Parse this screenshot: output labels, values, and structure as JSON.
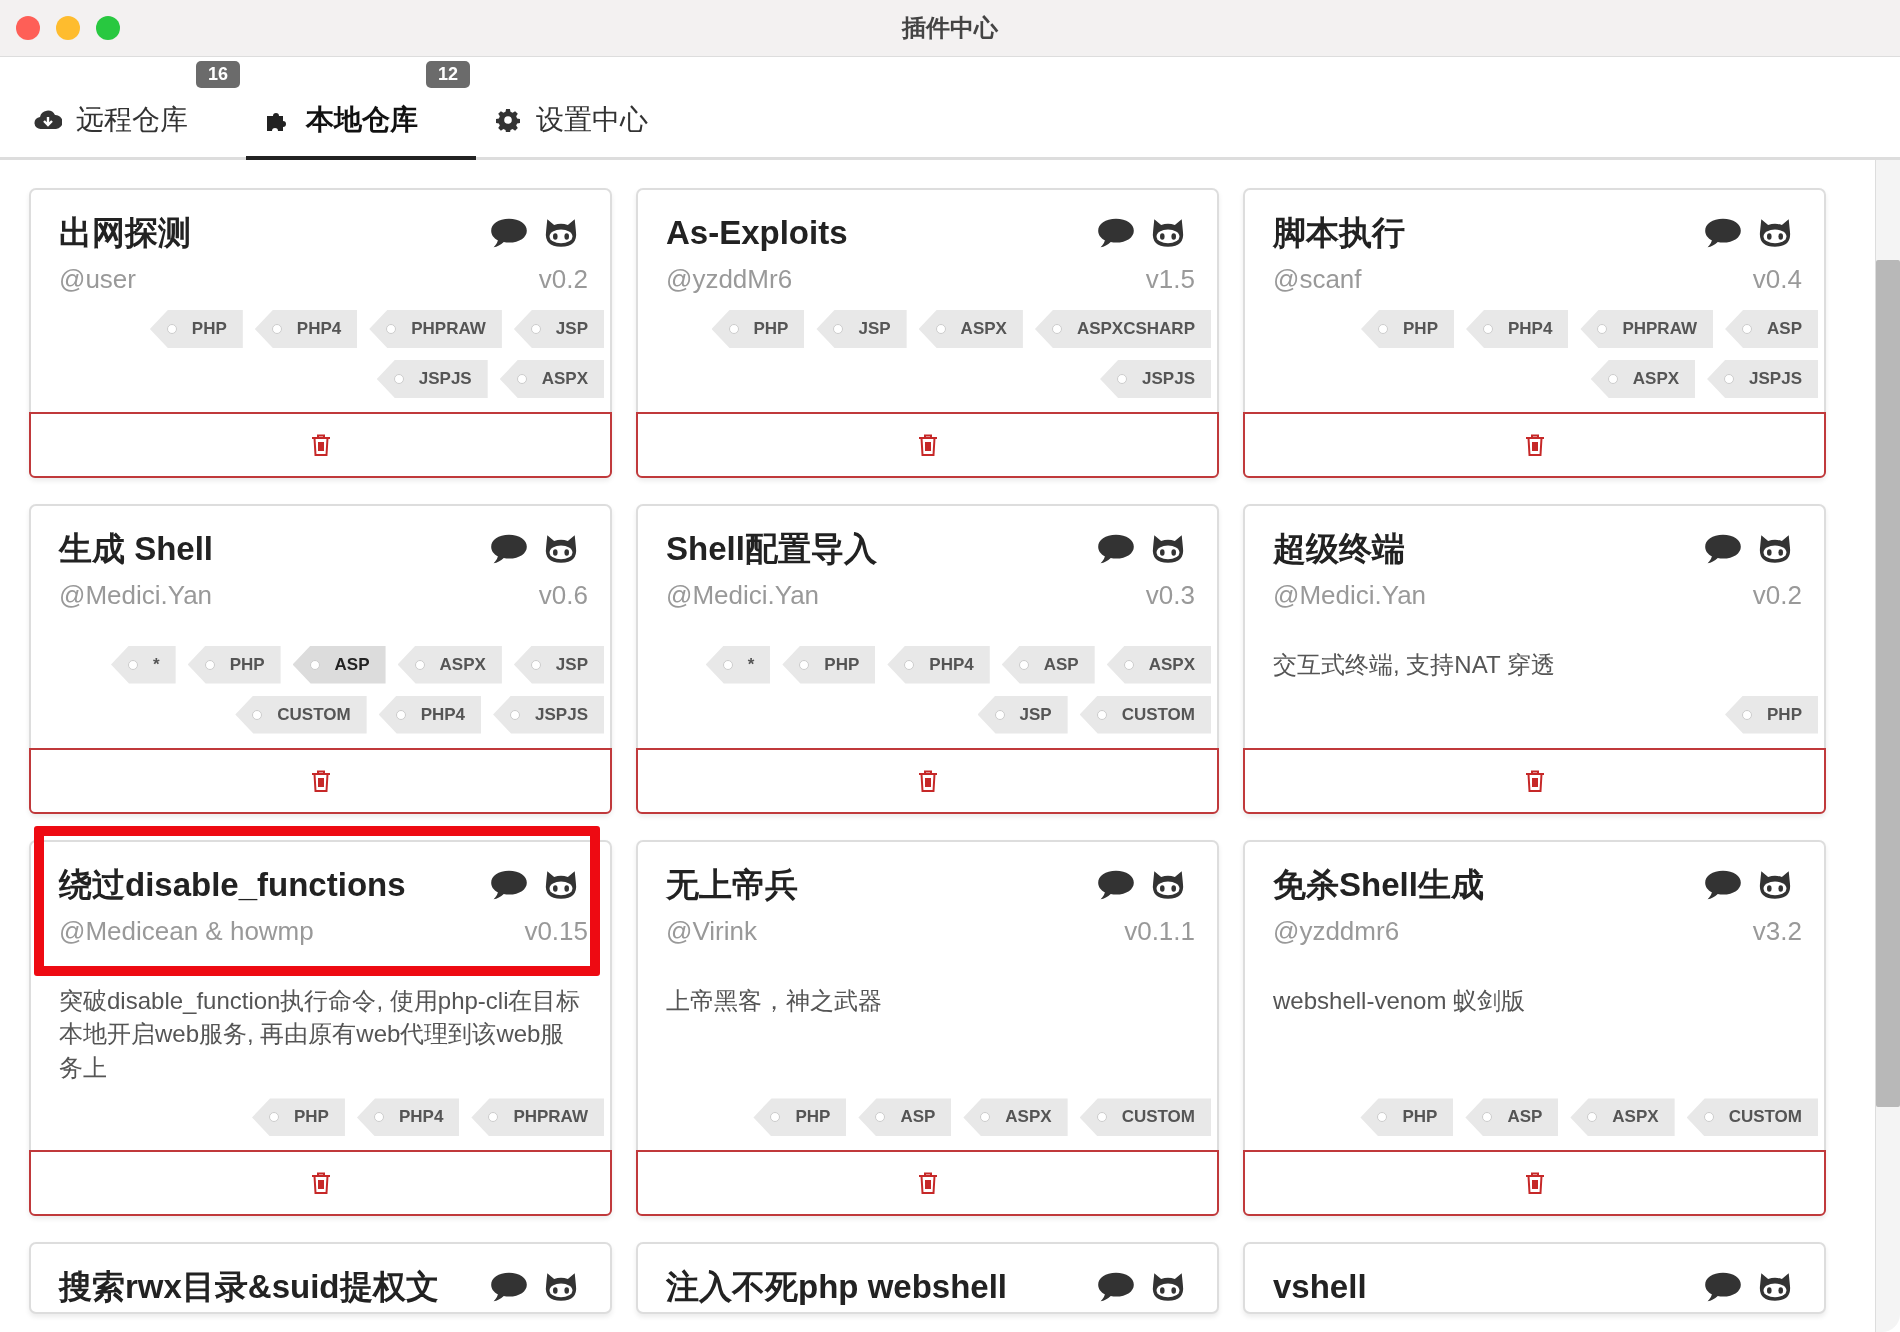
{
  "window": {
    "title": "插件中心"
  },
  "tabs": [
    {
      "label": "远程仓库",
      "badge": "16",
      "selected": false
    },
    {
      "label": "本地仓库",
      "badge": "12",
      "selected": true
    },
    {
      "label": "设置中心",
      "selected": false
    }
  ],
  "cards": [
    {
      "title": "出网探测",
      "author": "@user",
      "version": "v0.2",
      "highlighted": false,
      "tags": [
        {
          "label": "PHP",
          "selected": false
        },
        {
          "label": "PHP4",
          "selected": false
        },
        {
          "label": "PHPRAW",
          "selected": false
        },
        {
          "label": "JSP",
          "selected": false
        },
        {
          "label": "JSPJS",
          "selected": false
        },
        {
          "label": "ASPX",
          "selected": false
        }
      ]
    },
    {
      "title": "As-Exploits",
      "author": "@yzddMr6",
      "version": "v1.5",
      "highlighted": false,
      "tags": [
        {
          "label": "PHP",
          "selected": false
        },
        {
          "label": "JSP",
          "selected": false
        },
        {
          "label": "ASPX",
          "selected": false
        },
        {
          "label": "ASPXCSHARP",
          "selected": false
        },
        {
          "label": "JSPJS",
          "selected": false
        }
      ]
    },
    {
      "title": "脚本执行",
      "author": "@scanf",
      "version": "v0.4",
      "highlighted": false,
      "tags": [
        {
          "label": "PHP",
          "selected": false
        },
        {
          "label": "PHP4",
          "selected": false
        },
        {
          "label": "PHPRAW",
          "selected": false
        },
        {
          "label": "ASP",
          "selected": false
        },
        {
          "label": "ASPX",
          "selected": false
        },
        {
          "label": "JSPJS",
          "selected": false
        }
      ]
    },
    {
      "title": "生成 Shell",
      "author": "@Medici.Yan",
      "version": "v0.6",
      "highlighted": false,
      "tags": [
        {
          "label": "*",
          "selected": false
        },
        {
          "label": "PHP",
          "selected": false
        },
        {
          "label": "ASP",
          "selected": true
        },
        {
          "label": "ASPX",
          "selected": false
        },
        {
          "label": "JSP",
          "selected": false
        },
        {
          "label": "CUSTOM",
          "selected": false
        },
        {
          "label": "PHP4",
          "selected": false
        },
        {
          "label": "JSPJS",
          "selected": false
        }
      ]
    },
    {
      "title": "Shell配置导入",
      "author": "@Medici.Yan",
      "version": "v0.3",
      "highlighted": false,
      "tags": [
        {
          "label": "*",
          "selected": false
        },
        {
          "label": "PHP",
          "selected": false
        },
        {
          "label": "PHP4",
          "selected": false
        },
        {
          "label": "ASP",
          "selected": false
        },
        {
          "label": "ASPX",
          "selected": false
        },
        {
          "label": "JSP",
          "selected": false
        },
        {
          "label": "CUSTOM",
          "selected": false
        }
      ]
    },
    {
      "title": "超级终端",
      "author": "@Medici.Yan",
      "version": "v0.2",
      "highlighted": false,
      "description": "交互式终端, 支持NAT 穿透",
      "tags": [
        {
          "label": "PHP",
          "selected": false
        }
      ]
    },
    {
      "title": "绕过disable_functions",
      "author": "@Medicean & howmp",
      "version": "v0.15",
      "highlighted": true,
      "description": "突破disable_function执行命令, 使用php-cli在目标本地开启web服务, 再由原有web代理到该web服务上",
      "tags": [
        {
          "label": "PHP",
          "selected": false
        },
        {
          "label": "PHP4",
          "selected": false
        },
        {
          "label": "PHPRAW",
          "selected": false
        }
      ]
    },
    {
      "title": "无上帝兵",
      "author": "@Virink",
      "version": "v0.1.1",
      "highlighted": false,
      "description": "上帝黑客，神之武器",
      "tags": [
        {
          "label": "PHP",
          "selected": false
        },
        {
          "label": "ASP",
          "selected": false
        },
        {
          "label": "ASPX",
          "selected": false
        },
        {
          "label": "CUSTOM",
          "selected": false
        }
      ]
    },
    {
      "title": "免杀Shell生成",
      "author": "@yzddmr6",
      "version": "v3.2",
      "highlighted": false,
      "description": "webshell-venom 蚁剑版",
      "tags": [
        {
          "label": "PHP",
          "selected": false
        },
        {
          "label": "ASP",
          "selected": false
        },
        {
          "label": "ASPX",
          "selected": false
        },
        {
          "label": "CUSTOM",
          "selected": false
        }
      ]
    },
    {
      "title": "搜索rwx目录&suid提权文",
      "highlighted": false
    },
    {
      "title": "注入不死php webshell",
      "highlighted": false
    },
    {
      "title": "vshell",
      "highlighted": false
    }
  ]
}
